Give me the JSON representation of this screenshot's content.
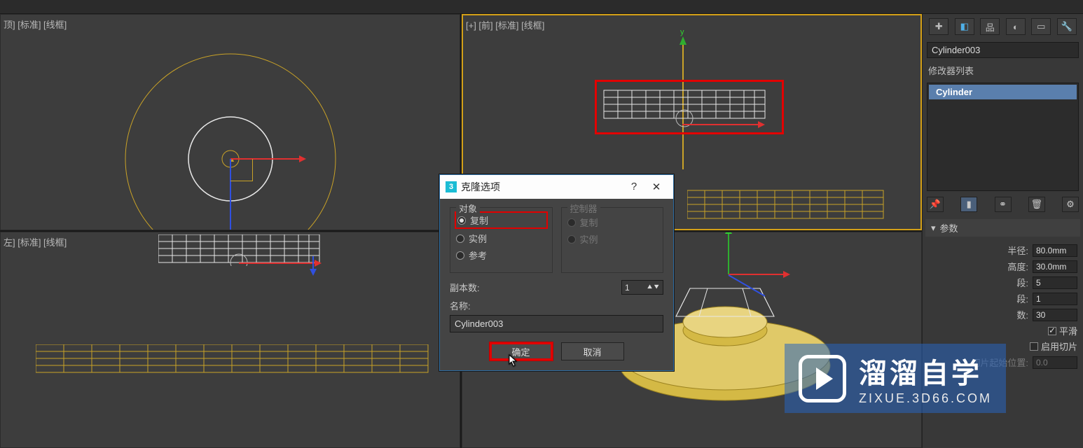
{
  "viewports": {
    "top": {
      "label": "顶] [标准] [线框]"
    },
    "front": {
      "label": "[+] [前] [标准] [线框]"
    },
    "left": {
      "label": "左] [标准] [线框]"
    },
    "persp": {
      "label": ""
    }
  },
  "dialog": {
    "title": "克隆选项",
    "help": "?",
    "close": "✕",
    "group_object": "对象",
    "group_controller": "控制器",
    "opt_copy": "复制",
    "opt_instance": "实例",
    "opt_reference": "参考",
    "ctrl_copy": "复制",
    "ctrl_instance": "实例",
    "copies_label": "副本数:",
    "copies_value": "1",
    "name_label": "名称:",
    "name_value": "Cylinder003",
    "ok": "确定",
    "cancel": "取消"
  },
  "panel": {
    "object_name": "Cylinder003",
    "modlist_label": "修改器列表",
    "mod_item": "Cylinder",
    "rollout": "参数",
    "radius_label": "半径:",
    "radius_value": "80.0mm",
    "height_label": "高度:",
    "height_value": "30.0mm",
    "hseg_label": "段:",
    "hseg_value": "5",
    "cseg_label": "段:",
    "cseg_value": "1",
    "sides_label": "数:",
    "sides_value": "30",
    "smooth_label": "平滑",
    "slice_label": "启用切片",
    "slice_from_label": "切片起始位置:",
    "slice_from_value": "0.0"
  },
  "watermark": {
    "big": "溜溜自学",
    "small": "ZIXUE.3D66.COM"
  },
  "axis": {
    "y": "y"
  }
}
